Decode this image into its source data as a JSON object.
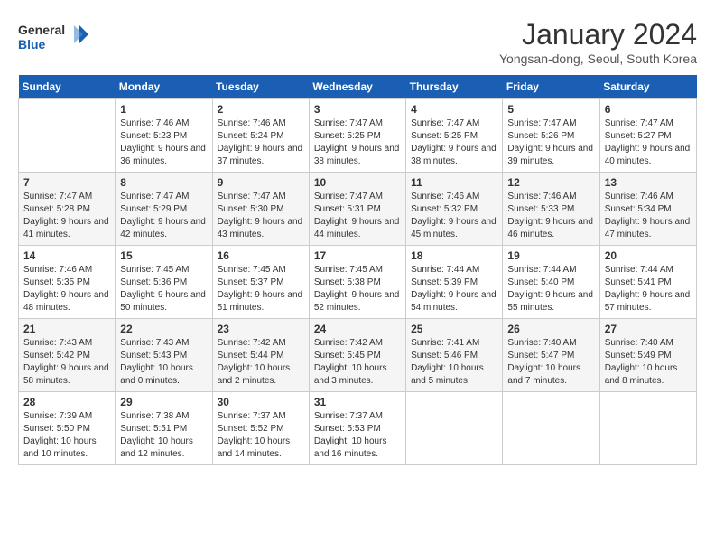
{
  "header": {
    "logo_line1": "General",
    "logo_line2": "Blue",
    "month_title": "January 2024",
    "location": "Yongsan-dong, Seoul, South Korea"
  },
  "days_of_week": [
    "Sunday",
    "Monday",
    "Tuesday",
    "Wednesday",
    "Thursday",
    "Friday",
    "Saturday"
  ],
  "weeks": [
    [
      {
        "day": "",
        "sunrise": "",
        "sunset": "",
        "daylight": ""
      },
      {
        "day": "1",
        "sunrise": "Sunrise: 7:46 AM",
        "sunset": "Sunset: 5:23 PM",
        "daylight": "Daylight: 9 hours and 36 minutes."
      },
      {
        "day": "2",
        "sunrise": "Sunrise: 7:46 AM",
        "sunset": "Sunset: 5:24 PM",
        "daylight": "Daylight: 9 hours and 37 minutes."
      },
      {
        "day": "3",
        "sunrise": "Sunrise: 7:47 AM",
        "sunset": "Sunset: 5:25 PM",
        "daylight": "Daylight: 9 hours and 38 minutes."
      },
      {
        "day": "4",
        "sunrise": "Sunrise: 7:47 AM",
        "sunset": "Sunset: 5:25 PM",
        "daylight": "Daylight: 9 hours and 38 minutes."
      },
      {
        "day": "5",
        "sunrise": "Sunrise: 7:47 AM",
        "sunset": "Sunset: 5:26 PM",
        "daylight": "Daylight: 9 hours and 39 minutes."
      },
      {
        "day": "6",
        "sunrise": "Sunrise: 7:47 AM",
        "sunset": "Sunset: 5:27 PM",
        "daylight": "Daylight: 9 hours and 40 minutes."
      }
    ],
    [
      {
        "day": "7",
        "sunrise": "Sunrise: 7:47 AM",
        "sunset": "Sunset: 5:28 PM",
        "daylight": "Daylight: 9 hours and 41 minutes."
      },
      {
        "day": "8",
        "sunrise": "Sunrise: 7:47 AM",
        "sunset": "Sunset: 5:29 PM",
        "daylight": "Daylight: 9 hours and 42 minutes."
      },
      {
        "day": "9",
        "sunrise": "Sunrise: 7:47 AM",
        "sunset": "Sunset: 5:30 PM",
        "daylight": "Daylight: 9 hours and 43 minutes."
      },
      {
        "day": "10",
        "sunrise": "Sunrise: 7:47 AM",
        "sunset": "Sunset: 5:31 PM",
        "daylight": "Daylight: 9 hours and 44 minutes."
      },
      {
        "day": "11",
        "sunrise": "Sunrise: 7:46 AM",
        "sunset": "Sunset: 5:32 PM",
        "daylight": "Daylight: 9 hours and 45 minutes."
      },
      {
        "day": "12",
        "sunrise": "Sunrise: 7:46 AM",
        "sunset": "Sunset: 5:33 PM",
        "daylight": "Daylight: 9 hours and 46 minutes."
      },
      {
        "day": "13",
        "sunrise": "Sunrise: 7:46 AM",
        "sunset": "Sunset: 5:34 PM",
        "daylight": "Daylight: 9 hours and 47 minutes."
      }
    ],
    [
      {
        "day": "14",
        "sunrise": "Sunrise: 7:46 AM",
        "sunset": "Sunset: 5:35 PM",
        "daylight": "Daylight: 9 hours and 48 minutes."
      },
      {
        "day": "15",
        "sunrise": "Sunrise: 7:45 AM",
        "sunset": "Sunset: 5:36 PM",
        "daylight": "Daylight: 9 hours and 50 minutes."
      },
      {
        "day": "16",
        "sunrise": "Sunrise: 7:45 AM",
        "sunset": "Sunset: 5:37 PM",
        "daylight": "Daylight: 9 hours and 51 minutes."
      },
      {
        "day": "17",
        "sunrise": "Sunrise: 7:45 AM",
        "sunset": "Sunset: 5:38 PM",
        "daylight": "Daylight: 9 hours and 52 minutes."
      },
      {
        "day": "18",
        "sunrise": "Sunrise: 7:44 AM",
        "sunset": "Sunset: 5:39 PM",
        "daylight": "Daylight: 9 hours and 54 minutes."
      },
      {
        "day": "19",
        "sunrise": "Sunrise: 7:44 AM",
        "sunset": "Sunset: 5:40 PM",
        "daylight": "Daylight: 9 hours and 55 minutes."
      },
      {
        "day": "20",
        "sunrise": "Sunrise: 7:44 AM",
        "sunset": "Sunset: 5:41 PM",
        "daylight": "Daylight: 9 hours and 57 minutes."
      }
    ],
    [
      {
        "day": "21",
        "sunrise": "Sunrise: 7:43 AM",
        "sunset": "Sunset: 5:42 PM",
        "daylight": "Daylight: 9 hours and 58 minutes."
      },
      {
        "day": "22",
        "sunrise": "Sunrise: 7:43 AM",
        "sunset": "Sunset: 5:43 PM",
        "daylight": "Daylight: 10 hours and 0 minutes."
      },
      {
        "day": "23",
        "sunrise": "Sunrise: 7:42 AM",
        "sunset": "Sunset: 5:44 PM",
        "daylight": "Daylight: 10 hours and 2 minutes."
      },
      {
        "day": "24",
        "sunrise": "Sunrise: 7:42 AM",
        "sunset": "Sunset: 5:45 PM",
        "daylight": "Daylight: 10 hours and 3 minutes."
      },
      {
        "day": "25",
        "sunrise": "Sunrise: 7:41 AM",
        "sunset": "Sunset: 5:46 PM",
        "daylight": "Daylight: 10 hours and 5 minutes."
      },
      {
        "day": "26",
        "sunrise": "Sunrise: 7:40 AM",
        "sunset": "Sunset: 5:47 PM",
        "daylight": "Daylight: 10 hours and 7 minutes."
      },
      {
        "day": "27",
        "sunrise": "Sunrise: 7:40 AM",
        "sunset": "Sunset: 5:49 PM",
        "daylight": "Daylight: 10 hours and 8 minutes."
      }
    ],
    [
      {
        "day": "28",
        "sunrise": "Sunrise: 7:39 AM",
        "sunset": "Sunset: 5:50 PM",
        "daylight": "Daylight: 10 hours and 10 minutes."
      },
      {
        "day": "29",
        "sunrise": "Sunrise: 7:38 AM",
        "sunset": "Sunset: 5:51 PM",
        "daylight": "Daylight: 10 hours and 12 minutes."
      },
      {
        "day": "30",
        "sunrise": "Sunrise: 7:37 AM",
        "sunset": "Sunset: 5:52 PM",
        "daylight": "Daylight: 10 hours and 14 minutes."
      },
      {
        "day": "31",
        "sunrise": "Sunrise: 7:37 AM",
        "sunset": "Sunset: 5:53 PM",
        "daylight": "Daylight: 10 hours and 16 minutes."
      },
      {
        "day": "",
        "sunrise": "",
        "sunset": "",
        "daylight": ""
      },
      {
        "day": "",
        "sunrise": "",
        "sunset": "",
        "daylight": ""
      },
      {
        "day": "",
        "sunrise": "",
        "sunset": "",
        "daylight": ""
      }
    ]
  ]
}
